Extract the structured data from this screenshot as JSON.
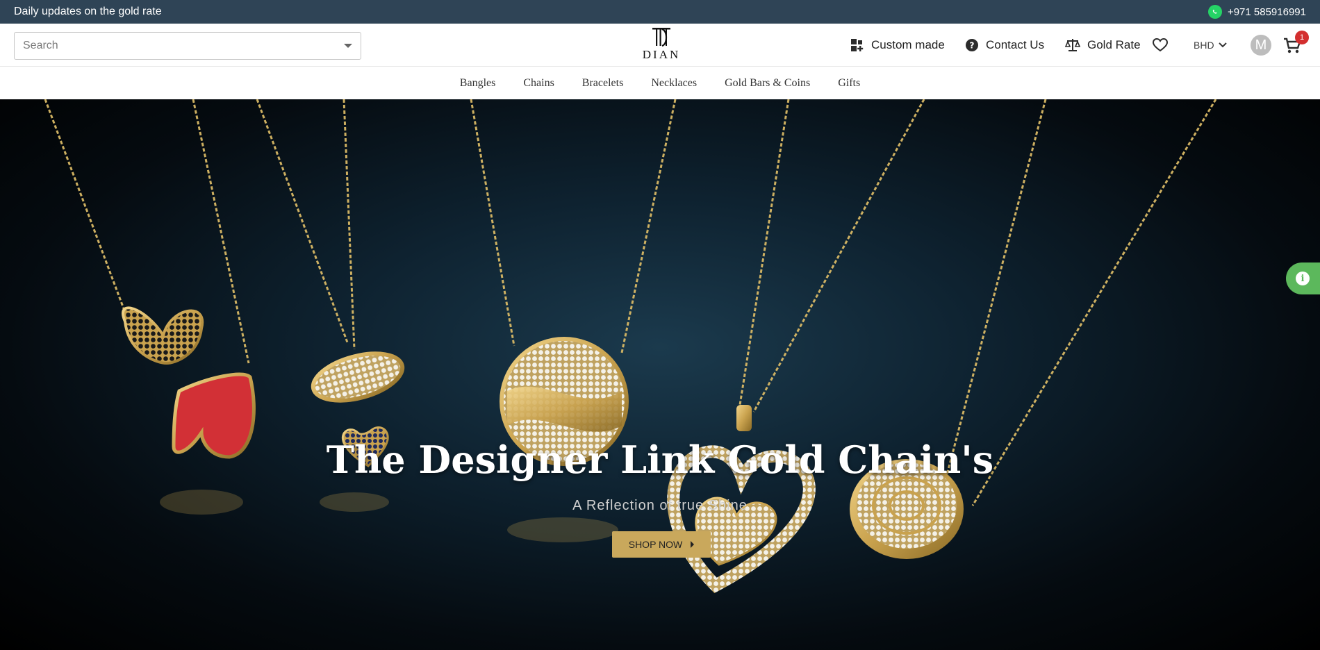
{
  "topbar": {
    "announcement": "Daily updates on the gold rate",
    "phone": "+971 585916991",
    "phone_icon": "whatsapp-icon"
  },
  "header": {
    "search_placeholder": "Search",
    "logo_text": "DIAN",
    "custom_made": "Custom made",
    "contact_us": "Contact Us",
    "gold_rate": "Gold Rate",
    "currency": "BHD",
    "avatar_initial": "M",
    "cart_count": "1"
  },
  "categories": [
    "Bangles",
    "Chains",
    "Bracelets",
    "Necklaces",
    "Gold Bars & Coins",
    "Gifts"
  ],
  "hero": {
    "title": "The Designer Link Gold Chain's",
    "subtitle": "A Reflection of true Shine",
    "cta": "SHOP NOW"
  },
  "colors": {
    "topbar_bg": "#2f4456",
    "accent_gold": "#c9a85c",
    "badge_red": "#d32f2f",
    "info_green": "#5cb85c"
  }
}
